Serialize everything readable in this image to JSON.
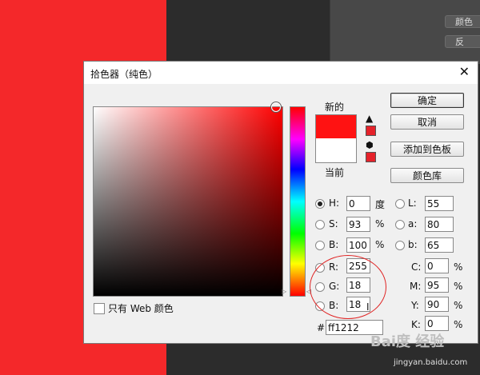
{
  "background": {
    "ps_buttons": [
      "颜色",
      "反"
    ]
  },
  "dialog": {
    "title": "拾色器（纯色）",
    "close_glyph": "✕",
    "preview": {
      "new_label": "新的",
      "current_label": "当前",
      "new_color": "#ff1212",
      "current_color": "#ffffff"
    },
    "buttons": {
      "ok": "确定",
      "cancel": "取消",
      "add_swatch": "添加到色板",
      "libraries": "颜色库"
    },
    "hsb": [
      {
        "label": "H:",
        "value": "0",
        "unit": "度"
      },
      {
        "label": "S:",
        "value": "93",
        "unit": "%"
      },
      {
        "label": "B:",
        "value": "100",
        "unit": "%"
      }
    ],
    "rgb": [
      {
        "label": "R:",
        "value": "255"
      },
      {
        "label": "G:",
        "value": "18"
      },
      {
        "label": "B:",
        "value": "18"
      }
    ],
    "lab": [
      {
        "label": "L:",
        "value": "55"
      },
      {
        "label": "a:",
        "value": "80"
      },
      {
        "label": "b:",
        "value": "65"
      }
    ],
    "cmyk": [
      {
        "label": "C:",
        "value": "0",
        "unit": "%"
      },
      {
        "label": "M:",
        "value": "95",
        "unit": "%"
      },
      {
        "label": "Y:",
        "value": "90",
        "unit": "%"
      },
      {
        "label": "K:",
        "value": "0",
        "unit": "%"
      }
    ],
    "hex": {
      "label": "#",
      "value": "ff1212"
    },
    "web_only": "只有 Web 颜色"
  },
  "watermark": {
    "text": "Bai度 经验",
    "url": "jingyan.baidu.com"
  }
}
